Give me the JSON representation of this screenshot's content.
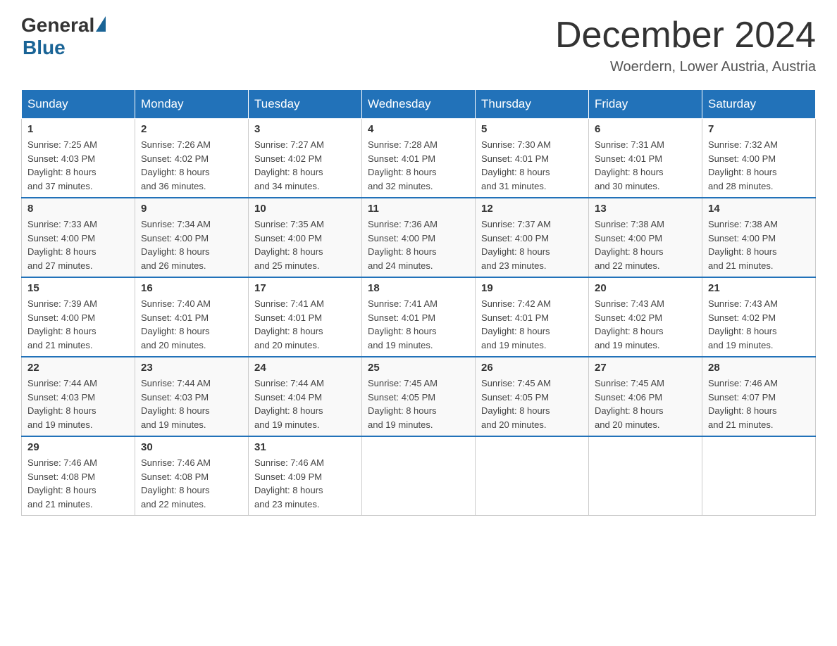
{
  "header": {
    "logo_general": "General",
    "logo_blue": "Blue",
    "title": "December 2024",
    "location": "Woerdern, Lower Austria, Austria"
  },
  "days_of_week": [
    "Sunday",
    "Monday",
    "Tuesday",
    "Wednesday",
    "Thursday",
    "Friday",
    "Saturday"
  ],
  "weeks": [
    [
      {
        "day": "1",
        "sunrise": "7:25 AM",
        "sunset": "4:03 PM",
        "daylight": "8 hours and 37 minutes."
      },
      {
        "day": "2",
        "sunrise": "7:26 AM",
        "sunset": "4:02 PM",
        "daylight": "8 hours and 36 minutes."
      },
      {
        "day": "3",
        "sunrise": "7:27 AM",
        "sunset": "4:02 PM",
        "daylight": "8 hours and 34 minutes."
      },
      {
        "day": "4",
        "sunrise": "7:28 AM",
        "sunset": "4:01 PM",
        "daylight": "8 hours and 32 minutes."
      },
      {
        "day": "5",
        "sunrise": "7:30 AM",
        "sunset": "4:01 PM",
        "daylight": "8 hours and 31 minutes."
      },
      {
        "day": "6",
        "sunrise": "7:31 AM",
        "sunset": "4:01 PM",
        "daylight": "8 hours and 30 minutes."
      },
      {
        "day": "7",
        "sunrise": "7:32 AM",
        "sunset": "4:00 PM",
        "daylight": "8 hours and 28 minutes."
      }
    ],
    [
      {
        "day": "8",
        "sunrise": "7:33 AM",
        "sunset": "4:00 PM",
        "daylight": "8 hours and 27 minutes."
      },
      {
        "day": "9",
        "sunrise": "7:34 AM",
        "sunset": "4:00 PM",
        "daylight": "8 hours and 26 minutes."
      },
      {
        "day": "10",
        "sunrise": "7:35 AM",
        "sunset": "4:00 PM",
        "daylight": "8 hours and 25 minutes."
      },
      {
        "day": "11",
        "sunrise": "7:36 AM",
        "sunset": "4:00 PM",
        "daylight": "8 hours and 24 minutes."
      },
      {
        "day": "12",
        "sunrise": "7:37 AM",
        "sunset": "4:00 PM",
        "daylight": "8 hours and 23 minutes."
      },
      {
        "day": "13",
        "sunrise": "7:38 AM",
        "sunset": "4:00 PM",
        "daylight": "8 hours and 22 minutes."
      },
      {
        "day": "14",
        "sunrise": "7:38 AM",
        "sunset": "4:00 PM",
        "daylight": "8 hours and 21 minutes."
      }
    ],
    [
      {
        "day": "15",
        "sunrise": "7:39 AM",
        "sunset": "4:00 PM",
        "daylight": "8 hours and 21 minutes."
      },
      {
        "day": "16",
        "sunrise": "7:40 AM",
        "sunset": "4:01 PM",
        "daylight": "8 hours and 20 minutes."
      },
      {
        "day": "17",
        "sunrise": "7:41 AM",
        "sunset": "4:01 PM",
        "daylight": "8 hours and 20 minutes."
      },
      {
        "day": "18",
        "sunrise": "7:41 AM",
        "sunset": "4:01 PM",
        "daylight": "8 hours and 19 minutes."
      },
      {
        "day": "19",
        "sunrise": "7:42 AM",
        "sunset": "4:01 PM",
        "daylight": "8 hours and 19 minutes."
      },
      {
        "day": "20",
        "sunrise": "7:43 AM",
        "sunset": "4:02 PM",
        "daylight": "8 hours and 19 minutes."
      },
      {
        "day": "21",
        "sunrise": "7:43 AM",
        "sunset": "4:02 PM",
        "daylight": "8 hours and 19 minutes."
      }
    ],
    [
      {
        "day": "22",
        "sunrise": "7:44 AM",
        "sunset": "4:03 PM",
        "daylight": "8 hours and 19 minutes."
      },
      {
        "day": "23",
        "sunrise": "7:44 AM",
        "sunset": "4:03 PM",
        "daylight": "8 hours and 19 minutes."
      },
      {
        "day": "24",
        "sunrise": "7:44 AM",
        "sunset": "4:04 PM",
        "daylight": "8 hours and 19 minutes."
      },
      {
        "day": "25",
        "sunrise": "7:45 AM",
        "sunset": "4:05 PM",
        "daylight": "8 hours and 19 minutes."
      },
      {
        "day": "26",
        "sunrise": "7:45 AM",
        "sunset": "4:05 PM",
        "daylight": "8 hours and 20 minutes."
      },
      {
        "day": "27",
        "sunrise": "7:45 AM",
        "sunset": "4:06 PM",
        "daylight": "8 hours and 20 minutes."
      },
      {
        "day": "28",
        "sunrise": "7:46 AM",
        "sunset": "4:07 PM",
        "daylight": "8 hours and 21 minutes."
      }
    ],
    [
      {
        "day": "29",
        "sunrise": "7:46 AM",
        "sunset": "4:08 PM",
        "daylight": "8 hours and 21 minutes."
      },
      {
        "day": "30",
        "sunrise": "7:46 AM",
        "sunset": "4:08 PM",
        "daylight": "8 hours and 22 minutes."
      },
      {
        "day": "31",
        "sunrise": "7:46 AM",
        "sunset": "4:09 PM",
        "daylight": "8 hours and 23 minutes."
      },
      null,
      null,
      null,
      null
    ]
  ],
  "labels": {
    "sunrise": "Sunrise:",
    "sunset": "Sunset:",
    "daylight": "Daylight:"
  }
}
